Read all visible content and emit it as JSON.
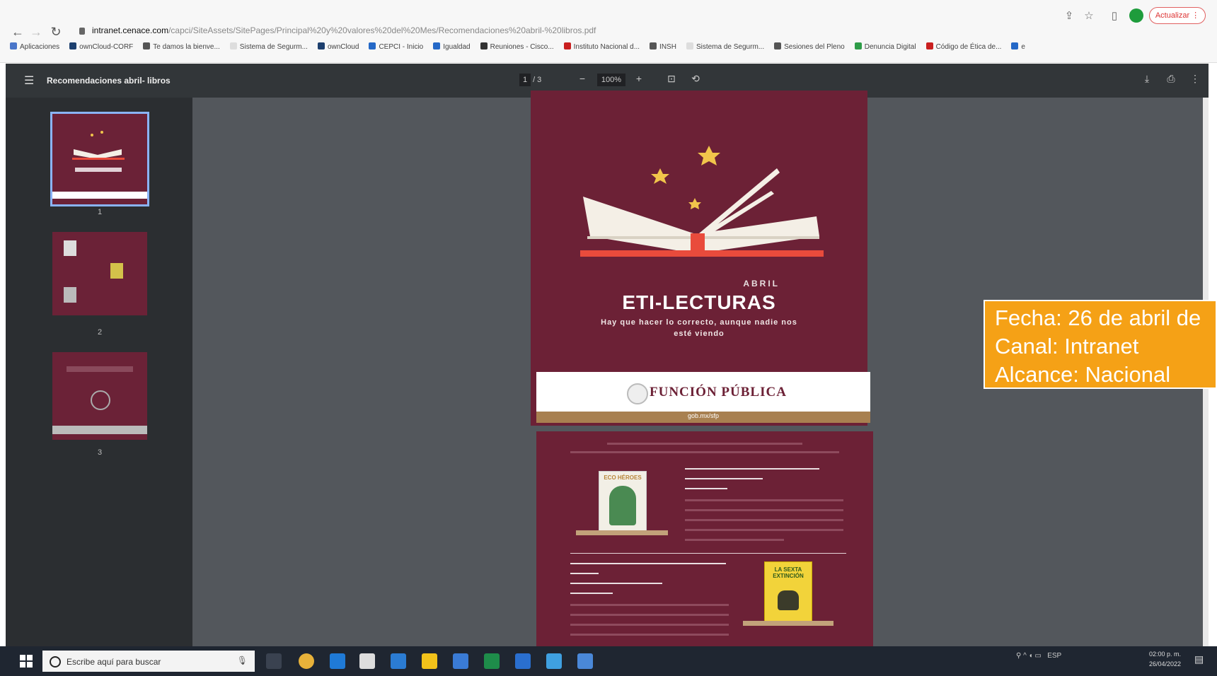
{
  "browser": {
    "url_host": "intranet.cenace.com",
    "url_path": "/capci/SiteAssets/SitePages/Principal%20y%20valores%20del%20Mes/Recomendaciones%20abril-%20libros.pdf",
    "update_label": "Actualizar",
    "avatar_letter": ""
  },
  "bookmarks": [
    {
      "label": "Aplicaciones",
      "color": "#4a76c9"
    },
    {
      "label": "ownCloud-CORF",
      "color": "#1c3f6e"
    },
    {
      "label": "Te damos la bienve...",
      "color": "#555555"
    },
    {
      "label": "Sistema de Segurm...",
      "color": "#dddddd"
    },
    {
      "label": "ownCloud",
      "color": "#1c3f6e"
    },
    {
      "label": "CEPCI - Inicio",
      "color": "#2468c7"
    },
    {
      "label": "Igualdad",
      "color": "#2468c7"
    },
    {
      "label": "Reuniones - Cisco...",
      "color": "#333333"
    },
    {
      "label": "Instituto Nacional d...",
      "color": "#c91f1f"
    },
    {
      "label": "INSH",
      "color": "#555555"
    },
    {
      "label": "Sistema de Segurm...",
      "color": "#dddddd"
    },
    {
      "label": "Sesiones del Pleno",
      "color": "#555555"
    },
    {
      "label": "Denuncia Digital",
      "color": "#2e9c48"
    },
    {
      "label": "Código de Ética de...",
      "color": "#c91f1f"
    },
    {
      "label": "e",
      "color": "#2468c7"
    }
  ],
  "pdf": {
    "title": "Recomendaciones abril- libros",
    "page_current": "1",
    "page_total": "/ 3",
    "zoom": "100%",
    "thumbnails": [
      "1",
      "2",
      "3"
    ]
  },
  "page1": {
    "month": "ABRIL",
    "heading": "ETI-LECTURAS",
    "tagline": "Hay que hacer lo correcto, aunque nadie nos esté viendo",
    "brand": "FUNCIÓN PÚBLICA",
    "social": "gob.mx/sfp",
    "bg_color": "#6c2136"
  },
  "page2": {
    "book1_title": "ECO HÉROES",
    "book2_title": "LA SEXTA EXTINCIÓN"
  },
  "info_box": {
    "line1": "Fecha: 26 de abril de",
    "line2": "Canal: Intranet",
    "line3": "Alcance: Nacional",
    "color": "#f5a116"
  },
  "taskbar": {
    "search_placeholder": "Escribe aquí para buscar",
    "language": "ESP",
    "time": "02:00 p. m.",
    "date": "26/04/2022"
  }
}
